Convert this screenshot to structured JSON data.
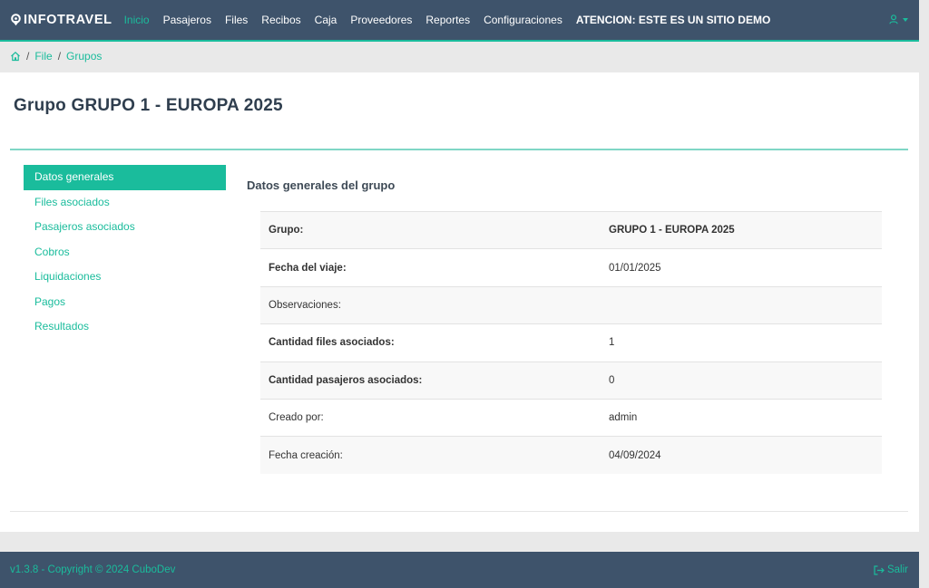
{
  "navbar": {
    "brand": "INFOTRAVEL",
    "items": [
      {
        "label": "Inicio",
        "active": true
      },
      {
        "label": "Pasajeros",
        "active": false
      },
      {
        "label": "Files",
        "active": false
      },
      {
        "label": "Recibos",
        "active": false
      },
      {
        "label": "Caja",
        "active": false
      },
      {
        "label": "Proveedores",
        "active": false
      },
      {
        "label": "Reportes",
        "active": false
      },
      {
        "label": "Configuraciones",
        "active": false
      }
    ],
    "demo_notice": "ATENCION: ESTE ES UN SITIO DEMO",
    "user_icon": "user-icon"
  },
  "breadcrumb": {
    "home_icon": "home-icon",
    "items": [
      "File",
      "Grupos"
    ]
  },
  "page": {
    "title": "Grupo GRUPO 1 - EUROPA 2025"
  },
  "side_menu": {
    "items": [
      {
        "label": "Datos generales",
        "active": true
      },
      {
        "label": "Files asociados",
        "active": false
      },
      {
        "label": "Pasajeros asociados",
        "active": false
      },
      {
        "label": "Cobros",
        "active": false
      },
      {
        "label": "Liquidaciones",
        "active": false
      },
      {
        "label": "Pagos",
        "active": false
      },
      {
        "label": "Resultados",
        "active": false
      }
    ]
  },
  "details": {
    "title": "Datos generales del grupo",
    "rows": [
      {
        "label": "Grupo:",
        "value": "GRUPO 1 - EUROPA 2025"
      },
      {
        "label": "Fecha del viaje:",
        "value": "01/01/2025"
      },
      {
        "label": "Observaciones:",
        "value": ""
      },
      {
        "label": "Cantidad files asociados:",
        "value": "1"
      },
      {
        "label": "Cantidad pasajeros asociados:",
        "value": "0"
      },
      {
        "label": "Creado por:",
        "value": "admin"
      },
      {
        "label": "Fecha creación:",
        "value": "04/09/2024"
      }
    ]
  },
  "footer": {
    "copyright": "v1.3.8 - Copyright © 2024 CuboDev",
    "logout_label": "Salir",
    "logout_icon": "sign-out-icon"
  },
  "colors": {
    "navbar_bg": "#3e536b",
    "accent": "#1abc9c",
    "page_bg": "#e9e9e9"
  }
}
